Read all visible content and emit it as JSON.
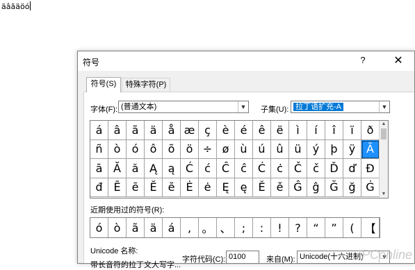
{
  "document": {
    "text": "äâãäöó"
  },
  "dialog": {
    "title": "符号",
    "help_glyph": "?",
    "close_glyph": "✕",
    "tabs": [
      {
        "label": "符号(S)"
      },
      {
        "label": "特殊字符(P)"
      }
    ],
    "font": {
      "label": "字体(F):",
      "value": "(普通文本)"
    },
    "subset": {
      "label": "子集(U):",
      "value": "拉丁语扩充-A"
    },
    "symbols": [
      "á",
      "â",
      "ã",
      "ä",
      "å",
      "æ",
      "ç",
      "è",
      "é",
      "ê",
      "ë",
      "ì",
      "í",
      "î",
      "ï",
      "ð",
      "ñ",
      "ò",
      "ó",
      "ô",
      "õ",
      "ö",
      "÷",
      "ø",
      "ù",
      "ú",
      "û",
      "ü",
      "ý",
      "þ",
      "ÿ",
      "Ā",
      "ā",
      "Ă",
      "ă",
      "Ą",
      "ą",
      "Ć",
      "ć",
      "Ĉ",
      "ĉ",
      "Ċ",
      "ċ",
      "Č",
      "č",
      "Ď",
      "ď",
      "Đ",
      "đ",
      "Ē",
      "ē",
      "Ĕ",
      "ĕ",
      "Ė",
      "ė",
      "Ę",
      "ę",
      "Ě",
      "ě",
      "Ĝ",
      "ĝ",
      "Ğ",
      "ğ",
      "Ġ"
    ],
    "selected_symbol": "Ā",
    "recent_label": "近期使用过的符号(R):",
    "recent_symbols": [
      "ó",
      "ò",
      "ã",
      "ä",
      "á",
      ",",
      "。",
      "、",
      ";",
      ":",
      "!",
      "?",
      "“",
      "”",
      "(",
      "【"
    ],
    "unicode_name_label": "Unicode 名称:",
    "unicode_name_value": "带长音符的拉丁文大写字...",
    "char_code": {
      "label": "字符代码(C):",
      "value": "0100"
    },
    "from": {
      "label": "来自(M):",
      "value": "Unicode(十六进制)"
    }
  },
  "watermark": "PConline"
}
